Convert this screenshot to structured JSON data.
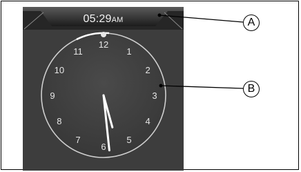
{
  "status_bar": {
    "time": "05:29",
    "ampm": "AM"
  },
  "clock": {
    "numerals": [
      "12",
      "1",
      "2",
      "3",
      "4",
      "5",
      "6",
      "7",
      "8",
      "9",
      "10",
      "11"
    ],
    "hour_value": 5,
    "minute_value": 29
  },
  "callouts": {
    "a": "A",
    "b": "B"
  },
  "colors": {
    "screen_bg": "#3d3d3d",
    "topbar_bg": "#2a2a2a",
    "hands": "#ffffff",
    "dial_ring": "#cfcfcf"
  }
}
